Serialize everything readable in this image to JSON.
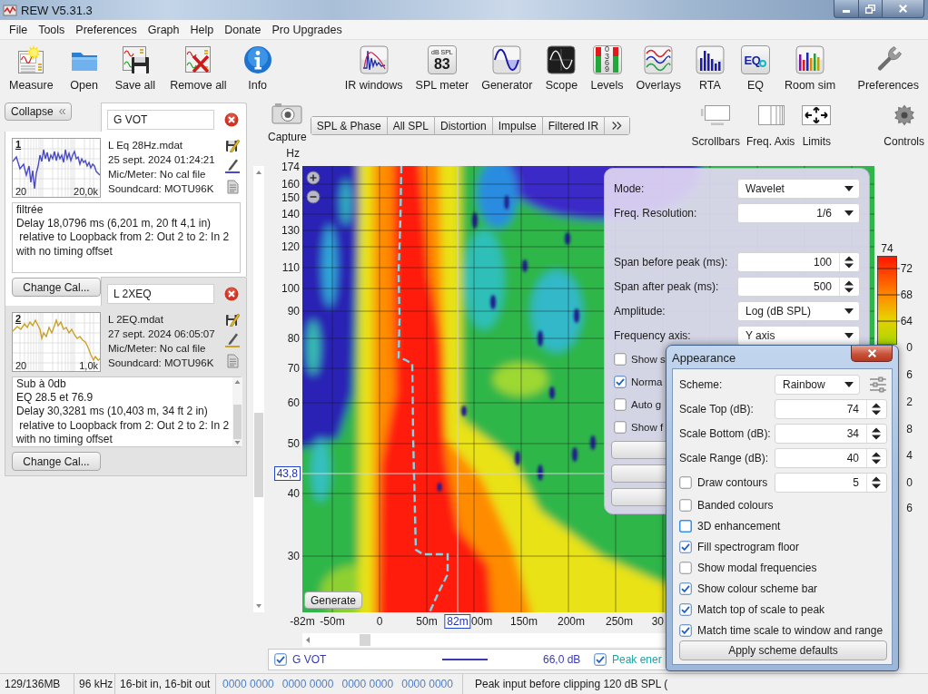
{
  "window": {
    "title": "REW V5.31.3"
  },
  "menu": [
    "File",
    "Tools",
    "Preferences",
    "Graph",
    "Help",
    "Donate",
    "Pro Upgrades"
  ],
  "toolbar": {
    "main": [
      {
        "kind": "measure",
        "label": "Measure"
      },
      {
        "kind": "open",
        "label": "Open"
      },
      {
        "kind": "saveall",
        "label": "Save all"
      },
      {
        "kind": "removeall",
        "label": "Remove all"
      },
      {
        "kind": "info",
        "label": "Info"
      }
    ],
    "tools": [
      {
        "kind": "irwindows",
        "label": "IR windows"
      },
      {
        "kind": "splmeter",
        "label": "SPL meter",
        "unit": "dB SPL",
        "reading": "83"
      },
      {
        "kind": "generator",
        "label": "Generator"
      },
      {
        "kind": "scope",
        "label": "Scope"
      },
      {
        "kind": "levels",
        "label": "Levels",
        "scale": "0369"
      },
      {
        "kind": "overlays",
        "label": "Overlays"
      },
      {
        "kind": "rta",
        "label": "RTA"
      },
      {
        "kind": "eq",
        "label": "EQ",
        "logo": "EQ"
      },
      {
        "kind": "roomsim",
        "label": "Room sim"
      }
    ],
    "settings": [
      {
        "kind": "preferences",
        "label": "Preferences"
      }
    ]
  },
  "measurements_panel": {
    "collapse_button": "Collapse",
    "measurements": [
      {
        "number": "1",
        "name": "G VOT",
        "selected": true,
        "color": "#4a4ac8",
        "file": "L Eq 28Hz.mdat",
        "date": "25 sept. 2024 01:24:21",
        "mic": "Mic/Meter: No cal file",
        "soundcard": "Soundcard: MOTU96K",
        "range_start": "20",
        "range_end": "20,0k",
        "notes": "filtrée\nDelay 18,0796 ms (6,201 m, 20 ft 4,1 in)\n relative to Loopback from 2: Out 2 to 2: In 2\nwith no timing offset",
        "cal_button": "Change Cal..."
      },
      {
        "number": "2",
        "name": "L 2XEQ",
        "selected": false,
        "color": "#c9a227",
        "file": "L 2EQ.mdat",
        "date": "27 sept. 2024 06:05:07",
        "mic": "Mic/Meter: No cal file",
        "soundcard": "Soundcard: MOTU96K",
        "range_start": "20",
        "range_end": "1,0k",
        "notes": "Sub à 0db\nEQ 28.5 et 76.9\nDelay 30,3281 ms (10,403 m, 34 ft 2 in)\n relative to Loopback from 2: Out 2 to 2: In 2\nwith no timing offset",
        "cal_button": "Change Cal..."
      }
    ]
  },
  "graph": {
    "capture_button": "Capture",
    "tabs": [
      {
        "label": "SPL & Phase",
        "selected": false
      },
      {
        "label": "All SPL",
        "selected": false
      },
      {
        "label": "Distortion",
        "selected": false
      },
      {
        "label": "Impulse",
        "selected": false
      },
      {
        "label": "Filtered IR",
        "selected": false
      }
    ],
    "tabs_overflow": true,
    "view_buttons": [
      {
        "kind": "scrollbars",
        "label": "Scrollbars"
      },
      {
        "kind": "freqaxis",
        "label": "Freq. Axis"
      },
      {
        "kind": "limits",
        "label": "Limits"
      },
      {
        "kind": "controls",
        "label": "Controls"
      }
    ],
    "y_axis": {
      "unit": "Hz",
      "labels": [
        "174",
        "160",
        "150",
        "140",
        "130",
        "120",
        "110",
        "100",
        "90",
        "80",
        "70",
        "60",
        "50",
        "40",
        "30"
      ],
      "cursor": "43,8"
    },
    "x_axis": {
      "labels": [
        "-82m",
        "-50m",
        "0",
        "50m",
        "00m",
        "150m",
        "200m",
        "250m",
        "30"
      ],
      "cursor": "82m"
    },
    "color_scale": {
      "labels": [
        "74",
        "72",
        "68",
        "64",
        "0",
        "6",
        "2",
        "8",
        "4",
        "0",
        "6"
      ]
    },
    "generate_button": "Generate",
    "controls": {
      "fields": [
        {
          "kind": "dropdown",
          "label": "Mode:",
          "value": "Wavelet"
        },
        {
          "kind": "choice",
          "label": "Freq. Resolution:",
          "value": "1/6"
        },
        {
          "kind": "spinner",
          "label": "Span before peak (ms):",
          "value": "100"
        },
        {
          "kind": "spinner",
          "label": "Span after peak (ms):",
          "value": "500"
        },
        {
          "kind": "dropdown",
          "label": "Amplitude:",
          "value": "Log (dB SPL)"
        },
        {
          "kind": "dropdown",
          "label": "Frequency axis:",
          "value": "Y axis"
        }
      ],
      "checkboxes": [
        {
          "label": "Show s",
          "checked": false
        },
        {
          "label": "Norma",
          "checked": true
        },
        {
          "label": "Auto g",
          "checked": false
        },
        {
          "label": "Show f",
          "checked": false
        }
      ]
    },
    "legend": [
      {
        "name": "G VOT",
        "checked": true,
        "color": "#3a3ab0",
        "value": "66,0 dB"
      },
      {
        "name": "Peak ener",
        "checked": true,
        "color": "#1fa3a3"
      }
    ]
  },
  "appearance_dialog": {
    "title": "Appearance",
    "rows": [
      {
        "kind": "dropdown",
        "label": "Scheme:",
        "value": "Rainbow"
      },
      {
        "kind": "spinner",
        "label": "Scale Top (dB):",
        "value": "74"
      },
      {
        "kind": "spinner",
        "label": "Scale Bottom (dB):",
        "value": "34"
      },
      {
        "kind": "spinner",
        "label": "Scale Range (dB):",
        "value": "40"
      },
      {
        "kind": "checkspinner",
        "label": "Draw contours",
        "checked": false,
        "focused": false,
        "value": "5"
      },
      {
        "kind": "checkbox",
        "label": "Banded colours",
        "checked": false,
        "focused": false
      },
      {
        "kind": "checkbox",
        "label": "3D enhancement",
        "checked": false,
        "focused": true
      },
      {
        "kind": "checkbox",
        "label": "Fill spectrogram floor",
        "checked": true,
        "focused": false
      },
      {
        "kind": "checkbox",
        "label": "Show modal frequencies",
        "checked": false,
        "focused": false
      },
      {
        "kind": "checkbox",
        "label": "Show colour scheme bar",
        "checked": true,
        "focused": false
      },
      {
        "kind": "checkbox",
        "label": "Match top of scale to peak",
        "checked": true,
        "focused": false
      },
      {
        "kind": "checkbox",
        "label": "Match time scale to window and range",
        "checked": true,
        "focused": false
      }
    ],
    "apply_button": "Apply scheme defaults"
  },
  "status_bar": {
    "memory": "129/136MB",
    "sample_rate": "96 kHz",
    "bit_depth": "16-bit in, 16-bit out",
    "level_readouts": [
      "0000 0000",
      "0000 0000",
      "0000 0000",
      "0000 0000"
    ],
    "message": "Peak input before clipping 120 dB SPL ("
  }
}
